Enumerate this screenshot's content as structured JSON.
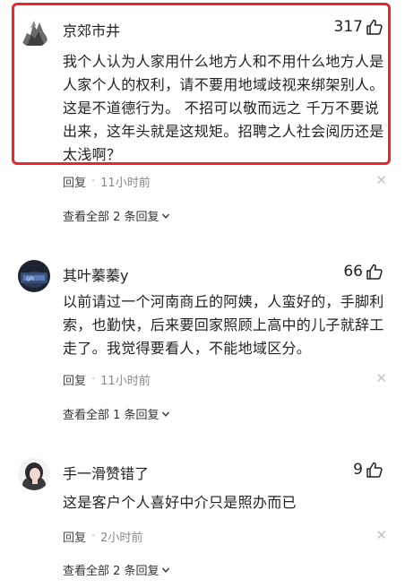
{
  "comments": [
    {
      "username": "京郊市井",
      "likes": "317",
      "text": "我个人认为人家用什么地方人和不用什么地方人是人家个人的权利，请不要用地域歧视来绑架别人。这是不道德行为。 不招可以敬而远之 千万不要说出来，这年头就是这规矩。招聘之人社会阅历还是太浅啊？",
      "reply_label": "回复",
      "separator": "·",
      "time": "11小时前",
      "view_replies": "查看全部 2 条回复",
      "highlighted": true
    },
    {
      "username": "其叶蓁蓁y",
      "likes": "66",
      "text": "以前请过一个河南商丘的阿姨，人蛮好的，手脚利索，也勤快，后来要回家照顾上高中的儿子就辞工走了。我觉得要看人，不能地域区分。",
      "reply_label": "回复",
      "separator": "·",
      "time": "11小时前",
      "view_replies": "查看全部 1 条回复",
      "highlighted": false
    },
    {
      "username": "手一滑赞错了",
      "likes": "9",
      "text": "这是客户个人喜好中介只是照办而已",
      "reply_label": "回复",
      "separator": "·",
      "time": "2小时前",
      "view_replies": "查看全部 2 条回复",
      "highlighted": false
    }
  ],
  "icons": {
    "like": "thumbs-up-icon",
    "close": "close-icon",
    "expand": "chevron-down-icon"
  },
  "colors": {
    "highlight_border": "#e8262c",
    "meta_gray": "#8a8a8a",
    "close_gray": "#c4c4c4"
  }
}
